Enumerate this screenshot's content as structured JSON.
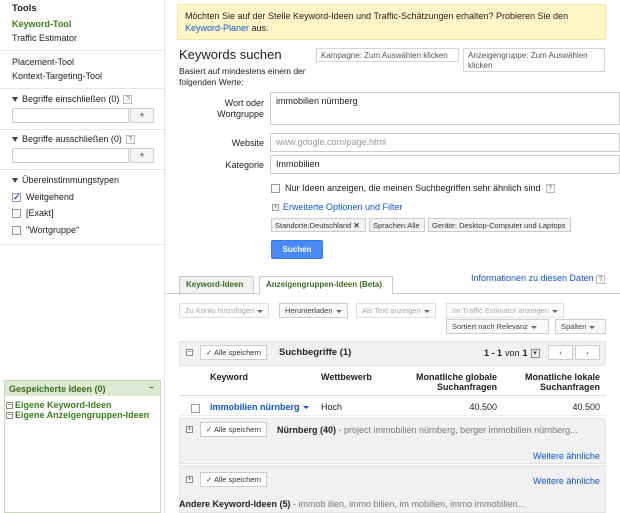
{
  "sidebar": {
    "tools_heading": "Tools",
    "tools": [
      "Keyword-Tool",
      "Traffic Estimator"
    ],
    "tools2": [
      "Placement-Tool",
      "Kontext-Targeting-Tool"
    ],
    "include_label": "Begriffe einschließen (0)",
    "exclude_label": "Begriffe ausschließen (0)",
    "match_label": "Übereinstimmungstypen",
    "match_options": [
      "Weitgehend",
      "[Exakt]",
      "\"Wortgruppe\""
    ],
    "plus_label": "+",
    "help_glyph": "?",
    "saved_title": "Gespeicherte Ideen (0)",
    "saved_min": "–",
    "saved_items": [
      "Eigene Keyword-Ideen",
      "Eigene Anzeigengruppen-Ideen"
    ]
  },
  "banner": {
    "text": "Möchten Sie auf der Stelle Keyword-Ideen und Traffic-Schätzungen erhalten? Probieren Sie den",
    "link": "Keyword-Planer",
    "suffix": " aus."
  },
  "search": {
    "title": "Keywords suchen",
    "subtitle": "Basiert auf mindestens einem der folgenden Werte:",
    "campaign_placeholder": "Kampagne: Zum Auswählen klicken",
    "adgroup_placeholder": "Anzeigengruppe: Zum Auswählen klicken",
    "keyword_label": "Wort oder Wortgruppe",
    "keyword_value": "immobilien nürnberg",
    "website_label": "Website",
    "website_placeholder": "www.google.com/page.html",
    "category_label": "Kategorie",
    "category_value": "Immobilien",
    "only_similar": "Nur Ideen anzeigen, die meinen Suchbegriffen sehr ähnlich sind",
    "advanced": "Erweiterte Optionen und Filter",
    "chips": [
      "Standorte:Deutschland",
      "Sprachen:Alle",
      "Geräte: Desktop-Computer und Laptops"
    ],
    "chip_remove": "✕",
    "submit": "Suchen"
  },
  "tabs": [
    "Keyword-Ideen",
    "Anzeigengruppen-Ideen (Beta)"
  ],
  "info_link": "Informationen zu diesen Daten",
  "toolbar": {
    "add_account": "Zu Konto hinzufügen",
    "download": "Herunterladen",
    "as_text": "Als Text anzeigen",
    "traffic": "Im Traffic Estimator anzeigen",
    "sort": "Sortiert nach Relevanz",
    "columns": "Spalten"
  },
  "suchbegriffe": {
    "save_all": "Alle speichern",
    "title": "Suchbegriffe (1)",
    "pagination": "1 - 1",
    "pagination_of": "von",
    "pagination_total": "1",
    "prev": "‹",
    "next": "›",
    "columns": {
      "keyword": "Keyword",
      "competition": "Wettbewerb",
      "global": "Monatliche globale Suchanfragen",
      "local": "Monatliche lokale Suchanfragen"
    },
    "rows": [
      {
        "keyword": "immobilien nürnberg",
        "competition": "Hoch",
        "global": "40.500",
        "local": "40.500"
      }
    ]
  },
  "group_nuernberg": {
    "save_all": "Alle speichern",
    "title": "Nürnberg (40)",
    "desc": " - project immobilien nürnberg, berger immobilien nürnberg...",
    "more": "Weitere ähnliche"
  },
  "group_third": {
    "save_all": "Alle speichern",
    "more": "Weitere ähnliche"
  },
  "group_other": {
    "title": "Andere Keyword-Ideen (5)",
    "desc": " - immob ilien, immo bilien, im mobilien, immo immobilien..."
  },
  "colors": {
    "link_blue": "#1155cc",
    "green": "#3a7e1e",
    "banner_bg": "#fff6c8",
    "button_blue": "#4a8af4"
  }
}
